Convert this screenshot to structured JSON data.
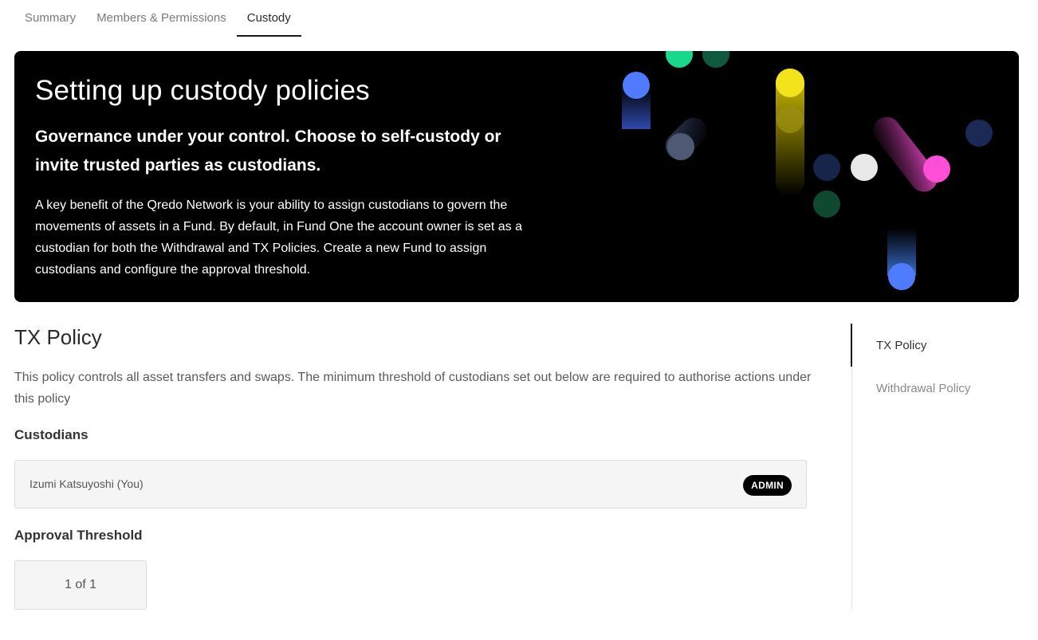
{
  "tabs": [
    {
      "label": "Summary"
    },
    {
      "label": "Members & Permissions"
    },
    {
      "label": "Custody"
    }
  ],
  "hero": {
    "title": "Setting up custody policies",
    "subtitle": "Governance under your control. Choose to self-custody or invite trusted parties as custodians.",
    "body": "A key benefit of the Qredo Network is your ability to assign custodians to govern the movements of assets in a Fund. By default, in Fund One the account owner is set as a custodian for both the Withdrawal and TX Policies. Create a new Fund to assign custodians and configure the approval threshold."
  },
  "policy": {
    "title": "TX Policy",
    "description": "This policy controls all asset transfers and swaps. The minimum threshold of custodians set out below are required to authorise actions under this policy",
    "custodians_label": "Custodians",
    "custodian": {
      "name": "Izumi Katsuyoshi (You)",
      "role": "ADMIN"
    },
    "threshold_label": "Approval Threshold",
    "threshold_value": "1 of 1"
  },
  "sidenav": {
    "items": [
      {
        "label": "TX Policy"
      },
      {
        "label": "Withdrawal Policy"
      }
    ]
  },
  "colors": {
    "accent": "#000000",
    "hero_dot_blue": "#4f7bff",
    "hero_dot_green": "#18d98b",
    "hero_dot_yellow": "#f2e31a",
    "hero_dot_pink": "#ff4fd8"
  }
}
